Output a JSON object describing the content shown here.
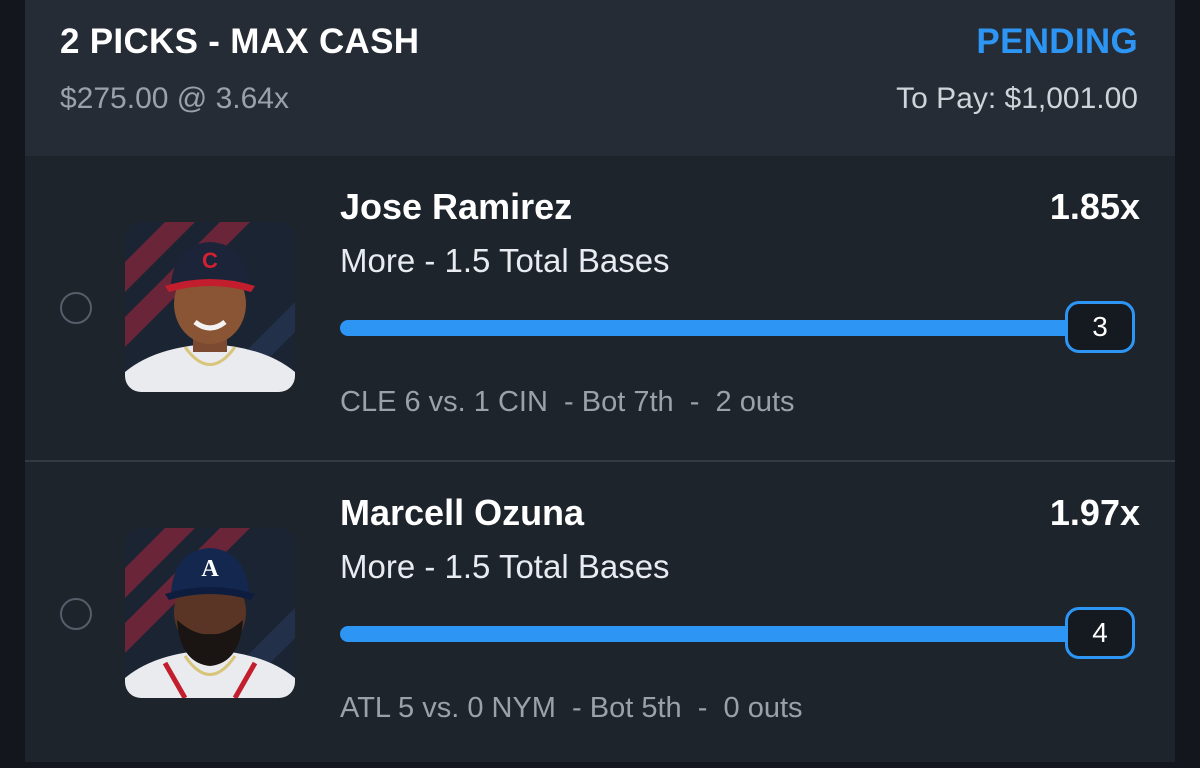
{
  "header": {
    "title": "2 PICKS - MAX CASH",
    "status": "PENDING",
    "stake_line": "$275.00 @ 3.64x",
    "to_pay": "To Pay: $1,001.00"
  },
  "picks": [
    {
      "player": "Jose Ramirez",
      "multiplier": "1.85x",
      "line": "More - 1.5 Total Bases",
      "current_count": "3",
      "game_status": "CLE 6 vs. 1 CIN  - Bot 7th  -  2 outs",
      "team_logo": "C",
      "cap_color": "#1b2438",
      "logo_color": "#d32031"
    },
    {
      "player": "Marcell Ozuna",
      "multiplier": "1.97x",
      "line": "More - 1.5 Total Bases",
      "current_count": "4",
      "game_status": "ATL 5 vs. 0 NYM  - Bot 5th  -  0 outs",
      "team_logo": "A",
      "cap_color": "#13274f",
      "logo_color": "#ffffff"
    }
  ],
  "colors": {
    "accent": "#2d96f5",
    "background": "#1e242c",
    "header_bg": "#252c35"
  }
}
